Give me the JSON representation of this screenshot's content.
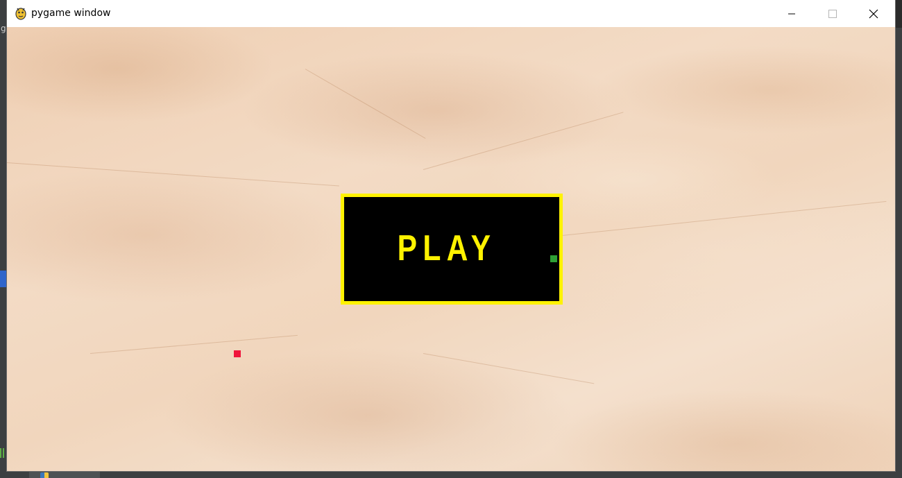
{
  "window": {
    "title": "pygame window",
    "controls": {
      "minimize_icon": "minimize-icon",
      "maximize_icon": "maximize-icon",
      "close_icon": "close-icon"
    }
  },
  "game": {
    "play_button": {
      "label": "PLAY",
      "fill_color": "#000000",
      "border_color": "#fff200",
      "text_color": "#fff200"
    },
    "food": {
      "color": "#f0143c"
    },
    "snake": {
      "color": "#2e9f35"
    },
    "background": "crumpled beige paper texture"
  },
  "taskbar": {
    "tab_icon": "python-icon"
  }
}
